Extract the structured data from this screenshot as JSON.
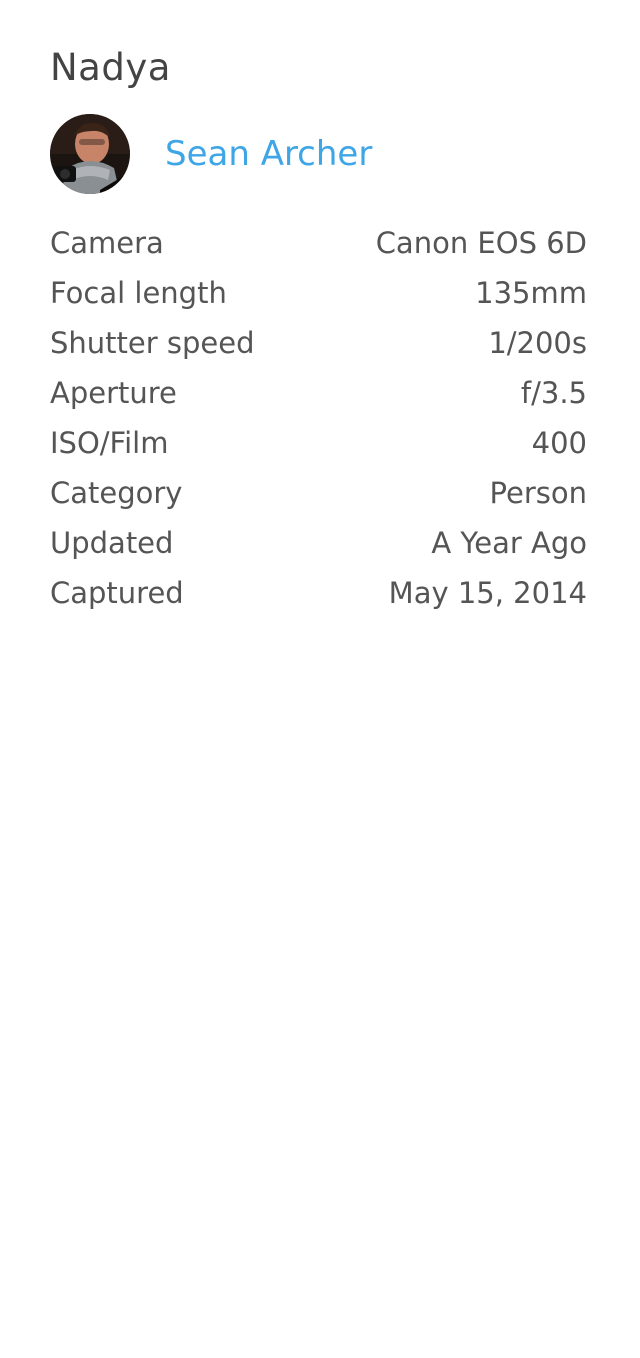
{
  "photo": {
    "title": "Nadya"
  },
  "author": {
    "name": "Sean Archer",
    "avatar_icon": "user-avatar-photo",
    "name_color": "#3ea5e6"
  },
  "details": [
    {
      "label": "Camera",
      "value": "Canon EOS 6D"
    },
    {
      "label": "Focal length",
      "value": "135mm"
    },
    {
      "label": "Shutter speed",
      "value": "1/200s"
    },
    {
      "label": "Aperture",
      "value": "f/3.5"
    },
    {
      "label": "ISO/Film",
      "value": "400"
    },
    {
      "label": "Category",
      "value": "Person"
    },
    {
      "label": "Updated",
      "value": "A Year Ago"
    },
    {
      "label": "Captured",
      "value": "May 15, 2014"
    }
  ]
}
